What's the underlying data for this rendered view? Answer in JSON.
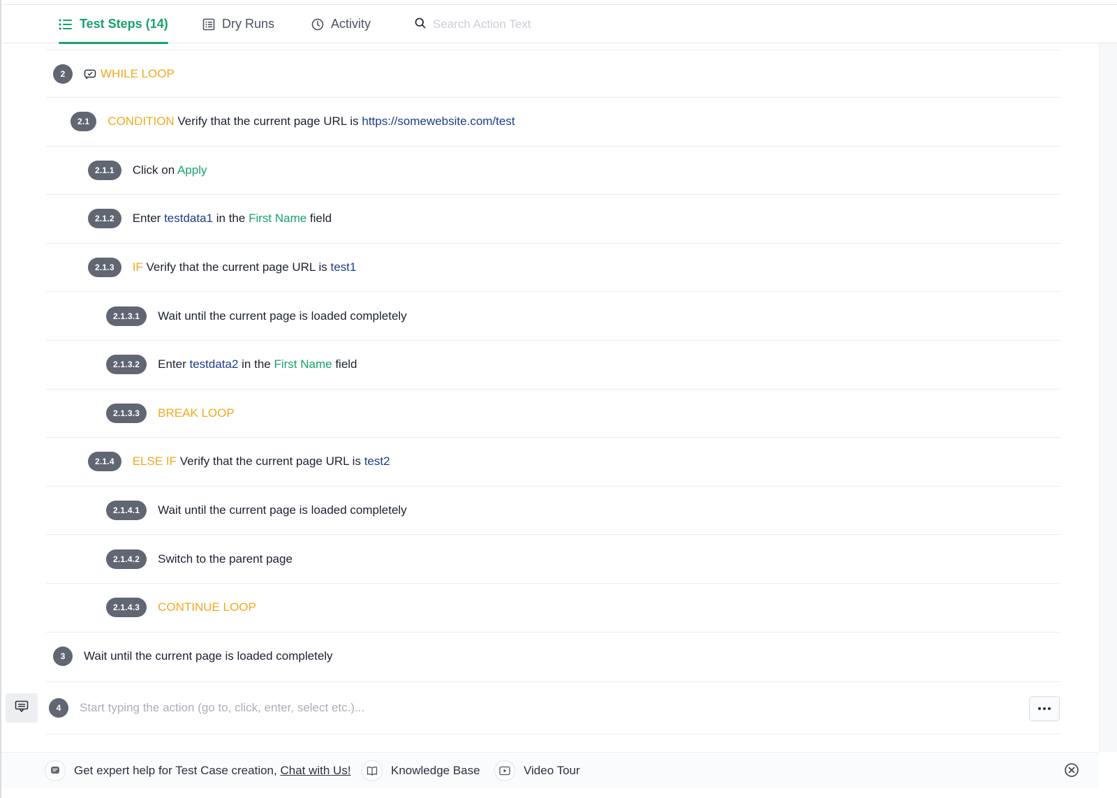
{
  "tabs": [
    {
      "label": "Test Steps (14)",
      "active": true,
      "icon": "list-icon"
    },
    {
      "label": "Dry Runs",
      "active": false,
      "icon": "report-icon"
    },
    {
      "label": "Activity",
      "active": false,
      "icon": "clock-icon"
    }
  ],
  "search": {
    "placeholder": "Search Action Text"
  },
  "steps": [
    {
      "num": "2",
      "level": 0,
      "icon": "loop-icon",
      "parts": [
        {
          "t": "WHILE LOOP",
          "c": "kw"
        }
      ]
    },
    {
      "num": "2.1",
      "level": 1,
      "parts": [
        {
          "t": "CONDITION",
          "c": "kw"
        },
        {
          "t": " Verify that the current page URL is ",
          "c": "txt"
        },
        {
          "t": "https://somewebsite.com/test",
          "c": "val"
        }
      ]
    },
    {
      "num": "2.1.1",
      "level": 2,
      "parts": [
        {
          "t": "Click on ",
          "c": "txt"
        },
        {
          "t": "Apply",
          "c": "el"
        }
      ]
    },
    {
      "num": "2.1.2",
      "level": 2,
      "parts": [
        {
          "t": "Enter ",
          "c": "txt"
        },
        {
          "t": "testdata1",
          "c": "val"
        },
        {
          "t": " in the ",
          "c": "txt"
        },
        {
          "t": "First Name",
          "c": "el"
        },
        {
          "t": " field",
          "c": "txt"
        }
      ]
    },
    {
      "num": "2.1.3",
      "level": 2,
      "parts": [
        {
          "t": "IF",
          "c": "kw"
        },
        {
          "t": " Verify that the current page URL is ",
          "c": "txt"
        },
        {
          "t": "test1",
          "c": "val"
        }
      ]
    },
    {
      "num": "2.1.3.1",
      "level": 3,
      "parts": [
        {
          "t": "Wait until the current page is loaded completely",
          "c": "txt"
        }
      ]
    },
    {
      "num": "2.1.3.2",
      "level": 3,
      "parts": [
        {
          "t": "Enter ",
          "c": "txt"
        },
        {
          "t": "testdata2",
          "c": "val"
        },
        {
          "t": " in the ",
          "c": "txt"
        },
        {
          "t": "First Name",
          "c": "el"
        },
        {
          "t": " field",
          "c": "txt"
        }
      ]
    },
    {
      "num": "2.1.3.3",
      "level": 3,
      "parts": [
        {
          "t": "BREAK LOOP",
          "c": "kw"
        }
      ]
    },
    {
      "num": "2.1.4",
      "level": 2,
      "parts": [
        {
          "t": "ELSE IF",
          "c": "kw"
        },
        {
          "t": " Verify that the current page URL is ",
          "c": "txt"
        },
        {
          "t": "test2",
          "c": "val"
        }
      ]
    },
    {
      "num": "2.1.4.1",
      "level": 3,
      "parts": [
        {
          "t": "Wait until the current page is loaded completely",
          "c": "txt"
        }
      ]
    },
    {
      "num": "2.1.4.2",
      "level": 3,
      "parts": [
        {
          "t": "Switch to the parent page",
          "c": "txt"
        }
      ]
    },
    {
      "num": "2.1.4.3",
      "level": 3,
      "parts": [
        {
          "t": "CONTINUE LOOP",
          "c": "kw"
        }
      ]
    },
    {
      "num": "3",
      "level": 0,
      "parts": [
        {
          "t": "Wait until the current page is loaded completely",
          "c": "txt"
        }
      ]
    }
  ],
  "new_step": {
    "num": "4",
    "placeholder": "Start typing the action (go to, click, enter, select etc.)..."
  },
  "footer": {
    "help_text": "Get expert help for Test Case creation,",
    "chat_link": "Chat with Us!",
    "knowledge_base": "Knowledge Base",
    "video_tour": "Video Tour"
  },
  "colors": {
    "accent": "#16a36a",
    "keyword": "#f2a81d",
    "value": "#1a3c8c",
    "badge": "#606772"
  }
}
